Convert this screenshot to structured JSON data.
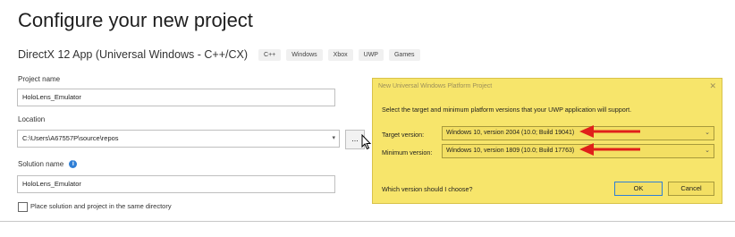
{
  "page": {
    "title": "Configure your new project",
    "template_name": "DirectX 12 App (Universal Windows - C++/CX)",
    "tags": [
      "C++",
      "Windows",
      "Xbox",
      "UWP",
      "Games"
    ]
  },
  "form": {
    "project_name_label": "Project name",
    "project_name_value": "HoloLens_Emulator",
    "location_label": "Location",
    "location_value": "C:\\Users\\A67557P\\source\\repos",
    "browse_label": "...",
    "solution_name_label": "Solution name",
    "solution_info_icon": "i",
    "solution_name_value": "HoloLens_Emulator",
    "same_dir_label": "Place solution and project in the same directory",
    "same_dir_checked": false
  },
  "dialog": {
    "title": "New Universal Windows Platform Project",
    "close_glyph": "✕",
    "instructions": "Select the target and minimum platform versions that your UWP application will support.",
    "target_label": "Target version:",
    "target_value": "Windows 10, version 2004 (10.0; Build 19041)",
    "minimum_label": "Minimum version:",
    "minimum_value": "Windows 10, version 1809 (10.0; Build 17763)",
    "help_link": "Which version should I choose?",
    "ok_label": "OK",
    "cancel_label": "Cancel",
    "background_color": "#f7e56b",
    "arrow_color": "#e0201b"
  },
  "icons": {
    "dropdown": "chevron-down-icon",
    "info": "info-icon",
    "cursor": "mouse-cursor-icon",
    "arrow": "red-arrow-icon"
  }
}
